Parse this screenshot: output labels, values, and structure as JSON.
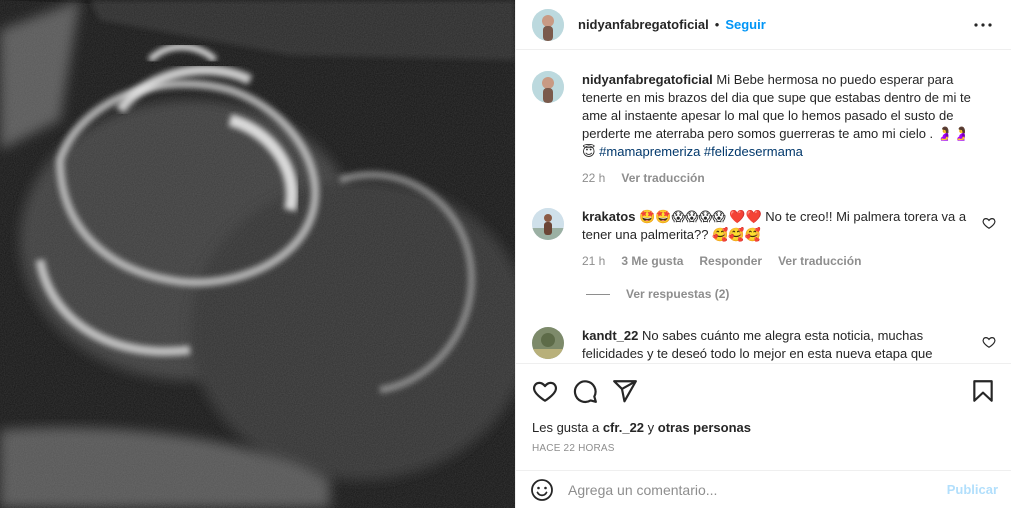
{
  "post": {
    "author": "nidyanfabregatoficial",
    "separator": "•",
    "follow_label": "Seguir",
    "image_alt": "Ecografía"
  },
  "caption": {
    "author": "nidyanfabregatoficial",
    "text": " Mi Bebe hermosa no puedo esperar para tenerte en mis brazos del dia que supe que estabas dentro de mi te ame al instaente apesar lo mal que lo hemos pasado el susto de perderte me aterraba pero somos guerreras te amo mi cielo . 🤰🤰😇 ",
    "tags": "#mamapremeriza #felizdesermama",
    "time": "22 h",
    "translate": "Ver traducción"
  },
  "comments": [
    {
      "author": "krakatos",
      "text": " 🤩🤩😱😱😱😱 ❤️❤️ No te creo!! Mi palmera torera va a tener una palmerita?? 🥰🥰🥰",
      "time": "21 h",
      "likes": "3 Me gusta",
      "reply": "Responder",
      "translate": "Ver traducción",
      "view_replies": "Ver respuestas (2)"
    },
    {
      "author": "kandt_22",
      "text": " No sabes cuánto me alegra esta noticia, muchas felicidades y te deseó todo lo mejor en esta nueva etapa que"
    }
  ],
  "likes": {
    "prefix": "Les gusta a ",
    "user": "cfr._22",
    "middle": " y ",
    "others": "otras personas"
  },
  "age": "HACE 22 HORAS",
  "add_comment": {
    "placeholder": "Agrega un comentario...",
    "publish": "Publicar"
  },
  "icons": {
    "emoji": "emoji-icon",
    "like": "heart-icon",
    "comment": "comment-icon",
    "share": "share-icon",
    "save": "bookmark-icon",
    "more": "more-icon"
  },
  "colors": {
    "link": "#0095f6",
    "tag": "#00376b",
    "muted": "#8e8e8e",
    "publish_disabled": "#b2dffc"
  }
}
